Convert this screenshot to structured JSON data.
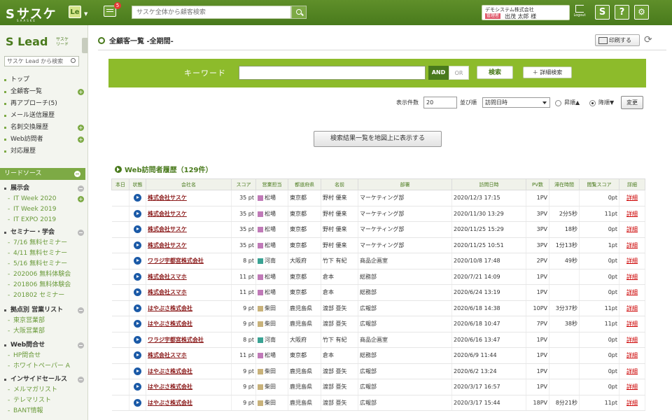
{
  "topbar": {
    "logo": "サスケ",
    "logo_sub": "SAASKE",
    "le_badge": "Le",
    "message_count": "5",
    "search_placeholder": "サスケ全体から顧客検索",
    "company": "デモシステム株式会社",
    "role": "管理者",
    "user": "出茂 太郎 様",
    "logout": "Logout"
  },
  "sidebar": {
    "lead_logo": "Lead",
    "lead_sub_1": "サスケ",
    "lead_sub_2": "リード",
    "search_placeholder": "サスケ Lead から検索",
    "items": [
      {
        "label": "トップ"
      },
      {
        "label": "全顧客一覧"
      },
      {
        "label": "再アプローチ(5)"
      },
      {
        "label": "メール送信履歴"
      },
      {
        "label": "名刺交換履歴"
      },
      {
        "label": "Web訪問者"
      },
      {
        "label": "対応履歴"
      }
    ],
    "section": "リードソース",
    "groups": [
      {
        "title": "展示会",
        "items": [
          "IT Week 2020",
          "IT Week 2019",
          "IT EXPO 2019"
        ]
      },
      {
        "title": "セミナー・学会",
        "items": [
          "7/16 無料セミナー",
          "4/11 無料セミナー",
          "5/16 無料セミナー",
          "202006 無料体験会",
          "201806 無料体験会",
          "201802 セミナー"
        ]
      },
      {
        "title": "拠点別 営業リスト",
        "items": [
          "東京営業部",
          "大阪営業部"
        ]
      },
      {
        "title": "Web問合せ",
        "items": [
          "HP問合せ",
          "ホワイトペーパー A"
        ]
      },
      {
        "title": "インサイドセールス",
        "items": [
          "メルマガリスト",
          "テレマリスト",
          "BANT情報"
        ]
      }
    ]
  },
  "main": {
    "title": "全顧客一覧 -全期間-",
    "print": "印刷する",
    "keyword_label": "キーワード",
    "and": "AND",
    "or": "OR",
    "search": "検索",
    "detail_search": "＋ 詳細検索",
    "count_label": "表示件数",
    "count_value": "20",
    "order_label": "並び順",
    "order_value": "訪問日時",
    "asc": "昇順▲",
    "desc": "降順▼",
    "change": "変更",
    "map_button": "検索結果一覧を地図上に表示する",
    "web_title": "Web訪問者履歴（129件）"
  },
  "table": {
    "headers": [
      "本日",
      "状態",
      "会社名",
      "スコア",
      "営業担当",
      "都道府県",
      "名前",
      "部署",
      "訪問日時",
      "PV数",
      "滞在時間",
      "閲覧スコア",
      "詳細"
    ],
    "rows": [
      {
        "company": "株式会社サスケ",
        "score": "35 pt",
        "rep": "松場",
        "rep_color": "#c07ab8",
        "pref": "東京都",
        "name": "野村 優来",
        "dept": "マーケティング部",
        "date": "2020/12/3 17:15",
        "pv": "1PV",
        "stay": "",
        "view": "0pt",
        "detail": "詳細"
      },
      {
        "company": "株式会社サスケ",
        "score": "35 pt",
        "rep": "松場",
        "rep_color": "#c07ab8",
        "pref": "東京都",
        "name": "野村 優来",
        "dept": "マーケティング部",
        "date": "2020/11/30 13:29",
        "pv": "3PV",
        "stay": "2分5秒",
        "view": "11pt",
        "detail": "詳細"
      },
      {
        "company": "株式会社サスケ",
        "score": "35 pt",
        "rep": "松場",
        "rep_color": "#c07ab8",
        "pref": "東京都",
        "name": "野村 優来",
        "dept": "マーケティング部",
        "date": "2020/11/25 15:29",
        "pv": "3PV",
        "stay": "18秒",
        "view": "0pt",
        "detail": "詳細"
      },
      {
        "company": "株式会社サスケ",
        "score": "35 pt",
        "rep": "松場",
        "rep_color": "#c07ab8",
        "pref": "東京都",
        "name": "野村 優来",
        "dept": "マーケティング部",
        "date": "2020/11/25 10:51",
        "pv": "3PV",
        "stay": "1分13秒",
        "view": "1pt",
        "detail": "詳細"
      },
      {
        "company": "ワラジ宇都宮株式会社",
        "score": "8 pt",
        "rep": "河南",
        "rep_color": "#3aa394",
        "pref": "大阪府",
        "name": "竹下 有紀",
        "dept": "商品企画室",
        "date": "2020/10/8 17:48",
        "pv": "2PV",
        "stay": "49秒",
        "view": "0pt",
        "detail": "詳細"
      },
      {
        "company": "株式会社スマホ",
        "score": "11 pt",
        "rep": "松場",
        "rep_color": "#c07ab8",
        "pref": "東京都",
        "name": "倉本",
        "dept": "総務部",
        "date": "2020/7/21 14:09",
        "pv": "1PV",
        "stay": "",
        "view": "0pt",
        "detail": "詳細"
      },
      {
        "company": "株式会社スマホ",
        "score": "11 pt",
        "rep": "松場",
        "rep_color": "#c07ab8",
        "pref": "東京都",
        "name": "倉本",
        "dept": "総務部",
        "date": "2020/6/24 13:19",
        "pv": "1PV",
        "stay": "",
        "view": "0pt",
        "detail": "詳細"
      },
      {
        "company": "はやぶさ株式会社",
        "score": "9 pt",
        "rep": "柴田",
        "rep_color": "#c9b27a",
        "pref": "鹿児島県",
        "name": "渡部 亜矢",
        "dept": "広報部",
        "date": "2020/6/18 14:38",
        "pv": "10PV",
        "stay": "3分37秒",
        "view": "11pt",
        "detail": "詳細"
      },
      {
        "company": "はやぶさ株式会社",
        "score": "9 pt",
        "rep": "柴田",
        "rep_color": "#c9b27a",
        "pref": "鹿児島県",
        "name": "渡部 亜矢",
        "dept": "広報部",
        "date": "2020/6/18 10:47",
        "pv": "7PV",
        "stay": "38秒",
        "view": "11pt",
        "detail": "詳細"
      },
      {
        "company": "ワラジ宇都宮株式会社",
        "score": "8 pt",
        "rep": "河南",
        "rep_color": "#3aa394",
        "pref": "大阪府",
        "name": "竹下 有紀",
        "dept": "商品企画室",
        "date": "2020/6/16 13:47",
        "pv": "1PV",
        "stay": "",
        "view": "0pt",
        "detail": "詳細"
      },
      {
        "company": "株式会社スマホ",
        "score": "11 pt",
        "rep": "松場",
        "rep_color": "#c07ab8",
        "pref": "東京都",
        "name": "倉本",
        "dept": "総務部",
        "date": "2020/6/9 11:44",
        "pv": "1PV",
        "stay": "",
        "view": "0pt",
        "detail": "詳細"
      },
      {
        "company": "はやぶさ株式会社",
        "score": "9 pt",
        "rep": "柴田",
        "rep_color": "#c9b27a",
        "pref": "鹿児島県",
        "name": "渡部 亜矢",
        "dept": "広報部",
        "date": "2020/6/2 13:24",
        "pv": "1PV",
        "stay": "",
        "view": "0pt",
        "detail": "詳細"
      },
      {
        "company": "はやぶさ株式会社",
        "score": "9 pt",
        "rep": "柴田",
        "rep_color": "#c9b27a",
        "pref": "鹿児島県",
        "name": "渡部 亜矢",
        "dept": "広報部",
        "date": "2020/3/17 16:57",
        "pv": "1PV",
        "stay": "",
        "view": "0pt",
        "detail": "詳細"
      },
      {
        "company": "はやぶさ株式会社",
        "score": "9 pt",
        "rep": "柴田",
        "rep_color": "#c9b27a",
        "pref": "鹿児島県",
        "name": "渡部 亜矢",
        "dept": "広報部",
        "date": "2020/3/17 15:44",
        "pv": "18PV",
        "stay": "8分21秒",
        "view": "11pt",
        "detail": "詳細"
      }
    ]
  }
}
